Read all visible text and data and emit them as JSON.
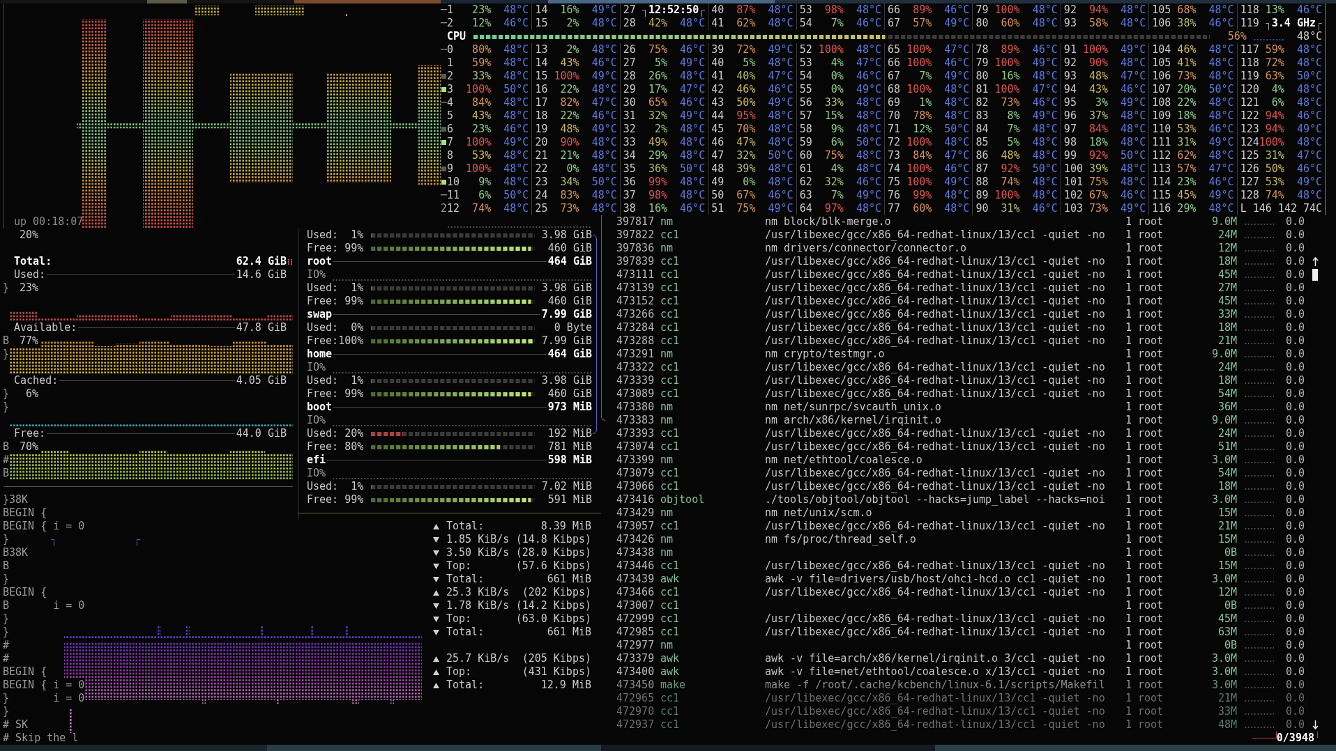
{
  "cpu": {
    "top_rows": [
      {
        "prefix": "─",
        "cores": [
          {
            "kind": "core",
            "id": "1",
            "usage": "23%",
            "color": "#8fca8a",
            "temp": "48°C"
          },
          {
            "kind": "core",
            "id": "14",
            "usage": "16%",
            "color": "#8fca8a",
            "temp": "49°C"
          },
          {
            "kind": "clock",
            "id": "27",
            "text": "12:52:50"
          },
          {
            "kind": "core",
            "id": "40",
            "usage": "87%",
            "color": "#dc5650",
            "temp": "48°C"
          },
          {
            "kind": "core",
            "id": "53",
            "usage": "98%",
            "color": "#dc5650",
            "temp": "48°C"
          },
          {
            "kind": "core",
            "id": "66",
            "usage": "89%",
            "color": "#dc5650",
            "temp": "46°C"
          },
          {
            "kind": "core",
            "id": "79",
            "usage": "100%",
            "color": "#dc5650",
            "temp": "48°C"
          },
          {
            "kind": "core",
            "id": "92",
            "usage": "94%",
            "color": "#dc5650",
            "temp": "48°C"
          },
          {
            "kind": "core",
            "id": "105",
            "usage": "68%",
            "color": "#d4935a",
            "temp": "48°C"
          },
          {
            "kind": "core",
            "id": "118",
            "usage": "13%",
            "color": "#8fca8a",
            "temp": "46°C"
          }
        ]
      },
      {
        "prefix": "─",
        "cores": [
          {
            "kind": "core",
            "id": "2",
            "usage": "12%",
            "color": "#8fca8a",
            "temp": "46°C"
          },
          {
            "kind": "core",
            "id": "15",
            "usage": "2%",
            "color": "#8fca8a",
            "temp": "48°C"
          },
          {
            "kind": "core",
            "id": "28",
            "usage": "42%",
            "color": "#c9b55e",
            "temp": "48°C"
          },
          {
            "kind": "core",
            "id": "41",
            "usage": "62%",
            "color": "#d4935a",
            "temp": "48°C"
          },
          {
            "kind": "core",
            "id": "54",
            "usage": "7%",
            "color": "#8fca8a",
            "temp": "46°C"
          },
          {
            "kind": "core",
            "id": "67",
            "usage": "57%",
            "color": "#d4935a",
            "temp": "49°C"
          },
          {
            "kind": "core",
            "id": "80",
            "usage": "60%",
            "color": "#d4935a",
            "temp": "48°C"
          },
          {
            "kind": "core",
            "id": "93",
            "usage": "58%",
            "color": "#d4935a",
            "temp": "48°C"
          },
          {
            "kind": "core",
            "id": "106",
            "usage": "38%",
            "color": "#b3bd6e",
            "temp": "46°C"
          },
          {
            "kind": "frequency",
            "id": "119",
            "text": "3.4 GHz"
          }
        ]
      }
    ],
    "summary": {
      "label": "CPU",
      "level": 0.56,
      "usage": "56%",
      "temp": "48°C"
    },
    "rows": [
      {
        "prefix": "─",
        "cores": [
          {
            "kind": "core",
            "id": "0",
            "usage": "80%",
            "color": "#d4935a",
            "temp": "48°C"
          },
          {
            "kind": "core",
            "id": "13",
            "usage": "2%",
            "color": "#8fca8a",
            "temp": "48°C"
          },
          {
            "kind": "core",
            "id": "26",
            "usage": "75%",
            "color": "#d4935a",
            "temp": "46°C"
          },
          {
            "kind": "core",
            "id": "39",
            "usage": "72%",
            "color": "#d4935a",
            "temp": "49°C"
          },
          {
            "kind": "core",
            "id": "52",
            "usage": "100%",
            "color": "#dc5650",
            "temp": "48°C"
          },
          {
            "kind": "core",
            "id": "65",
            "usage": "100%",
            "color": "#dc5650",
            "temp": "47°C"
          },
          {
            "kind": "core",
            "id": "78",
            "usage": "89%",
            "color": "#dc5650",
            "temp": "46°C"
          },
          {
            "kind": "core",
            "id": "91",
            "usage": "100%",
            "color": "#dc5650",
            "temp": "49°C"
          },
          {
            "kind": "core",
            "id": "104",
            "usage": "46%",
            "color": "#c9b55e",
            "temp": "48°C"
          },
          {
            "kind": "core",
            "id": "117",
            "usage": "59%",
            "color": "#d4935a",
            "temp": "48°C"
          }
        ]
      },
      {
        "cores": [
          {
            "kind": "core",
            "id": "1",
            "usage": "59%",
            "color": "#d4935a",
            "temp": "48°C"
          },
          {
            "kind": "core",
            "id": "14",
            "usage": "43%",
            "color": "#c9b55e",
            "temp": "46°C"
          },
          {
            "kind": "core",
            "id": "27",
            "usage": "5%",
            "color": "#8fca8a",
            "temp": "49°C"
          },
          {
            "kind": "core",
            "id": "40",
            "usage": "5%",
            "color": "#8fca8a",
            "temp": "48°C"
          },
          {
            "kind": "core",
            "id": "53",
            "usage": "4%",
            "color": "#8fca8a",
            "temp": "47°C"
          },
          {
            "kind": "core",
            "id": "66",
            "usage": "100%",
            "color": "#dc5650",
            "temp": "46°C"
          },
          {
            "kind": "core",
            "id": "79",
            "usage": "100%",
            "color": "#dc5650",
            "temp": "49°C"
          },
          {
            "kind": "core",
            "id": "92",
            "usage": "90%",
            "color": "#dc5650",
            "temp": "48°C"
          },
          {
            "kind": "core",
            "id": "105",
            "usage": "41%",
            "color": "#c9b55e",
            "temp": "48°C"
          },
          {
            "kind": "core",
            "id": "118",
            "usage": "72%",
            "color": "#d4935a",
            "temp": "48°C"
          }
        ]
      },
      {
        "color": "#5a5a5a",
        "cores": [
          {
            "kind": "core",
            "id": "2",
            "usage": "33%",
            "color": "#b3bd6e",
            "temp": "48°C"
          },
          {
            "kind": "core",
            "id": "15",
            "usage": "100%",
            "color": "#dc5650",
            "temp": "49°C"
          },
          {
            "kind": "core",
            "id": "28",
            "usage": "26%",
            "color": "#8fca8a",
            "temp": "48°C"
          },
          {
            "kind": "core",
            "id": "41",
            "usage": "40%",
            "color": "#b3bd6e",
            "temp": "47°C"
          },
          {
            "kind": "core",
            "id": "54",
            "usage": "0%",
            "color": "#8fca8a",
            "temp": "46°C"
          },
          {
            "kind": "core",
            "id": "67",
            "usage": "7%",
            "color": "#8fca8a",
            "temp": "49°C"
          },
          {
            "kind": "core",
            "id": "80",
            "usage": "16%",
            "color": "#8fca8a",
            "temp": "48°C"
          },
          {
            "kind": "core",
            "id": "93",
            "usage": "48%",
            "color": "#c9b55e",
            "temp": "47°C"
          },
          {
            "kind": "core",
            "id": "106",
            "usage": "73%",
            "color": "#d4935a",
            "temp": "48°C"
          },
          {
            "kind": "core",
            "id": "119",
            "usage": "63%",
            "color": "#d4935a",
            "temp": "50°C"
          }
        ]
      },
      {
        "color": "#a6e07c",
        "cores": [
          {
            "kind": "core",
            "id": "3",
            "usage": "100%",
            "color": "#dc5650",
            "temp": "50°C"
          },
          {
            "kind": "core",
            "id": "16",
            "usage": "22%",
            "color": "#8fca8a",
            "temp": "48°C"
          },
          {
            "kind": "core",
            "id": "29",
            "usage": "17%",
            "color": "#8fca8a",
            "temp": "47°C"
          },
          {
            "kind": "core",
            "id": "42",
            "usage": "46%",
            "color": "#c9b55e",
            "temp": "46°C"
          },
          {
            "kind": "core",
            "id": "55",
            "usage": "0%",
            "color": "#8fca8a",
            "temp": "49°C"
          },
          {
            "kind": "core",
            "id": "68",
            "usage": "100%",
            "color": "#dc5650",
            "temp": "48°C"
          },
          {
            "kind": "core",
            "id": "81",
            "usage": "100%",
            "color": "#dc5650",
            "temp": "47°C"
          },
          {
            "kind": "core",
            "id": "94",
            "usage": "43%",
            "color": "#c9b55e",
            "temp": "46°C"
          },
          {
            "kind": "core",
            "id": "107",
            "usage": "20%",
            "color": "#8fca8a",
            "temp": "50°C"
          },
          {
            "kind": "core",
            "id": "120",
            "usage": "4%",
            "color": "#8fca8a",
            "temp": "48°C"
          }
        ]
      },
      {
        "prefix": "─",
        "cores": [
          {
            "kind": "core",
            "id": "4",
            "usage": "84%",
            "color": "#d4935a",
            "temp": "48°C"
          },
          {
            "kind": "core",
            "id": "17",
            "usage": "82%",
            "color": "#d4935a",
            "temp": "47°C"
          },
          {
            "kind": "core",
            "id": "30",
            "usage": "65%",
            "color": "#d4935a",
            "temp": "46°C"
          },
          {
            "kind": "core",
            "id": "43",
            "usage": "50%",
            "color": "#c9b55e",
            "temp": "49°C"
          },
          {
            "kind": "core",
            "id": "56",
            "usage": "33%",
            "color": "#b3bd6e",
            "temp": "48°C"
          },
          {
            "kind": "core",
            "id": "69",
            "usage": "1%",
            "color": "#8fca8a",
            "temp": "48°C"
          },
          {
            "kind": "core",
            "id": "82",
            "usage": "73%",
            "color": "#d4935a",
            "temp": "46°C"
          },
          {
            "kind": "core",
            "id": "95",
            "usage": "3%",
            "color": "#8fca8a",
            "temp": "49°C"
          },
          {
            "kind": "core",
            "id": "108",
            "usage": "22%",
            "color": "#8fca8a",
            "temp": "48°C"
          },
          {
            "kind": "core",
            "id": "121",
            "usage": "6%",
            "color": "#8fca8a",
            "temp": "48°C"
          }
        ]
      },
      {
        "cores": [
          {
            "kind": "core",
            "id": "5",
            "usage": "43%",
            "color": "#c9b55e",
            "temp": "48°C"
          },
          {
            "kind": "core",
            "id": "18",
            "usage": "22%",
            "color": "#8fca8a",
            "temp": "46°C"
          },
          {
            "kind": "core",
            "id": "31",
            "usage": "32%",
            "color": "#b3bd6e",
            "temp": "49°C"
          },
          {
            "kind": "core",
            "id": "44",
            "usage": "95%",
            "color": "#dc5650",
            "temp": "48°C"
          },
          {
            "kind": "core",
            "id": "57",
            "usage": "15%",
            "color": "#8fca8a",
            "temp": "48°C"
          },
          {
            "kind": "core",
            "id": "70",
            "usage": "78%",
            "color": "#d4935a",
            "temp": "48°C"
          },
          {
            "kind": "core",
            "id": "83",
            "usage": "8%",
            "color": "#8fca8a",
            "temp": "49°C"
          },
          {
            "kind": "core",
            "id": "96",
            "usage": "37%",
            "color": "#b3bd6e",
            "temp": "48°C"
          },
          {
            "kind": "core",
            "id": "109",
            "usage": "18%",
            "color": "#8fca8a",
            "temp": "48°C"
          },
          {
            "kind": "core",
            "id": "122",
            "usage": "94%",
            "color": "#dc5650",
            "temp": "46°C"
          }
        ]
      },
      {
        "color": "#5a5a5a",
        "cores": [
          {
            "kind": "core",
            "id": "6",
            "usage": "23%",
            "color": "#8fca8a",
            "temp": "46°C"
          },
          {
            "kind": "core",
            "id": "19",
            "usage": "48%",
            "color": "#c9b55e",
            "temp": "49°C"
          },
          {
            "kind": "core",
            "id": "32",
            "usage": "2%",
            "color": "#8fca8a",
            "temp": "48°C"
          },
          {
            "kind": "core",
            "id": "45",
            "usage": "70%",
            "color": "#d4935a",
            "temp": "48°C"
          },
          {
            "kind": "core",
            "id": "58",
            "usage": "9%",
            "color": "#8fca8a",
            "temp": "48°C"
          },
          {
            "kind": "core",
            "id": "71",
            "usage": "12%",
            "color": "#8fca8a",
            "temp": "50°C"
          },
          {
            "kind": "core",
            "id": "84",
            "usage": "7%",
            "color": "#8fca8a",
            "temp": "48°C"
          },
          {
            "kind": "core",
            "id": "97",
            "usage": "84%",
            "color": "#dc5650",
            "temp": "48°C"
          },
          {
            "kind": "core",
            "id": "110",
            "usage": "53%",
            "color": "#c9b55e",
            "temp": "46°C"
          },
          {
            "kind": "core",
            "id": "123",
            "usage": "94%",
            "color": "#dc5650",
            "temp": "49°C"
          }
        ]
      },
      {
        "color": "#a6e07c",
        "cores": [
          {
            "kind": "core",
            "id": "7",
            "usage": "100%",
            "color": "#dc5650",
            "temp": "49°C"
          },
          {
            "kind": "core",
            "id": "20",
            "usage": "90%",
            "color": "#dc5650",
            "temp": "48°C"
          },
          {
            "kind": "core",
            "id": "33",
            "usage": "49%",
            "color": "#c9b55e",
            "temp": "48°C"
          },
          {
            "kind": "core",
            "id": "46",
            "usage": "47%",
            "color": "#c9b55e",
            "temp": "48°C"
          },
          {
            "kind": "core",
            "id": "59",
            "usage": "6%",
            "color": "#8fca8a",
            "temp": "50°C"
          },
          {
            "kind": "core",
            "id": "72",
            "usage": "100%",
            "color": "#dc5650",
            "temp": "48°C"
          },
          {
            "kind": "core",
            "id": "85",
            "usage": "5%",
            "color": "#8fca8a",
            "temp": "48°C"
          },
          {
            "kind": "core",
            "id": "98",
            "usage": "18%",
            "color": "#8fca8a",
            "temp": "48°C"
          },
          {
            "kind": "core",
            "id": "111",
            "usage": "31%",
            "color": "#b3bd6e",
            "temp": "49°C"
          },
          {
            "kind": "core",
            "id": "124",
            "usage": "100%",
            "color": "#dc5650",
            "temp": "48°C"
          }
        ]
      },
      {
        "cores": [
          {
            "kind": "core",
            "id": "8",
            "usage": "53%",
            "color": "#c9b55e",
            "temp": "48°C"
          },
          {
            "kind": "core",
            "id": "21",
            "usage": "21%",
            "color": "#8fca8a",
            "temp": "48°C"
          },
          {
            "kind": "core",
            "id": "34",
            "usage": "29%",
            "color": "#8fca8a",
            "temp": "48°C"
          },
          {
            "kind": "core",
            "id": "47",
            "usage": "32%",
            "color": "#b3bd6e",
            "temp": "50°C"
          },
          {
            "kind": "core",
            "id": "60",
            "usage": "75%",
            "color": "#d4935a",
            "temp": "48°C"
          },
          {
            "kind": "core",
            "id": "73",
            "usage": "84%",
            "color": "#d4935a",
            "temp": "47°C"
          },
          {
            "kind": "core",
            "id": "86",
            "usage": "48%",
            "color": "#c9b55e",
            "temp": "48°C"
          },
          {
            "kind": "core",
            "id": "99",
            "usage": "92%",
            "color": "#dc5650",
            "temp": "50°C"
          },
          {
            "kind": "core",
            "id": "112",
            "usage": "62%",
            "color": "#d4935a",
            "temp": "48°C"
          },
          {
            "kind": "core",
            "id": "125",
            "usage": "31%",
            "color": "#b3bd6e",
            "temp": "47°C"
          }
        ]
      },
      {
        "color": "#5a5a5a",
        "cores": [
          {
            "kind": "core",
            "id": "9",
            "usage": "100%",
            "color": "#dc5650",
            "temp": "48°C"
          },
          {
            "kind": "core",
            "id": "22",
            "usage": "0%",
            "color": "#8fca8a",
            "temp": "48°C"
          },
          {
            "kind": "core",
            "id": "35",
            "usage": "36%",
            "color": "#b3bd6e",
            "temp": "50°C"
          },
          {
            "kind": "core",
            "id": "48",
            "usage": "39%",
            "color": "#b3bd6e",
            "temp": "48°C"
          },
          {
            "kind": "core",
            "id": "61",
            "usage": "4%",
            "color": "#8fca8a",
            "temp": "48°C"
          },
          {
            "kind": "core",
            "id": "74",
            "usage": "100%",
            "color": "#dc5650",
            "temp": "46°C"
          },
          {
            "kind": "core",
            "id": "87",
            "usage": "92%",
            "color": "#dc5650",
            "temp": "50°C"
          },
          {
            "kind": "core",
            "id": "100",
            "usage": "39%",
            "color": "#b3bd6e",
            "temp": "48°C"
          },
          {
            "kind": "core",
            "id": "113",
            "usage": "57%",
            "color": "#d4935a",
            "temp": "47°C"
          },
          {
            "kind": "core",
            "id": "126",
            "usage": "50%",
            "color": "#c9b55e",
            "temp": "46°C"
          }
        ]
      },
      {
        "color": "#a6e07c",
        "cores": [
          {
            "kind": "core",
            "id": "10",
            "usage": "9%",
            "color": "#8fca8a",
            "temp": "48°C"
          },
          {
            "kind": "core",
            "id": "23",
            "usage": "34%",
            "color": "#b3bd6e",
            "temp": "50°C"
          },
          {
            "kind": "core",
            "id": "36",
            "usage": "99%",
            "color": "#dc5650",
            "temp": "48°C"
          },
          {
            "kind": "core",
            "id": "49",
            "usage": "0%",
            "color": "#8fca8a",
            "temp": "48°C"
          },
          {
            "kind": "core",
            "id": "62",
            "usage": "32%",
            "color": "#b3bd6e",
            "temp": "46°C"
          },
          {
            "kind": "core",
            "id": "75",
            "usage": "100%",
            "color": "#dc5650",
            "temp": "49°C"
          },
          {
            "kind": "core",
            "id": "88",
            "usage": "74%",
            "color": "#d4935a",
            "temp": "48°C"
          },
          {
            "kind": "core",
            "id": "101",
            "usage": "75%",
            "color": "#d4935a",
            "temp": "48°C"
          },
          {
            "kind": "core",
            "id": "114",
            "usage": "23%",
            "color": "#8fca8a",
            "temp": "46°C"
          },
          {
            "kind": "core",
            "id": "127",
            "usage": "53%",
            "color": "#c9b55e",
            "temp": "49°C"
          }
        ]
      },
      {
        "prefix": "─",
        "cores": [
          {
            "kind": "core",
            "id": "11",
            "usage": "6%",
            "color": "#8fca8a",
            "temp": "50°C"
          },
          {
            "kind": "core",
            "id": "24",
            "usage": "83%",
            "color": "#d4935a",
            "temp": "48°C"
          },
          {
            "kind": "core",
            "id": "37",
            "usage": "98%",
            "color": "#dc5650",
            "temp": "48°C"
          },
          {
            "kind": "core",
            "id": "50",
            "usage": "67%",
            "color": "#d4935a",
            "temp": "46°C"
          },
          {
            "kind": "core",
            "id": "63",
            "usage": "7%",
            "color": "#8fca8a",
            "temp": "49°C"
          },
          {
            "kind": "core",
            "id": "76",
            "usage": "99%",
            "color": "#dc5650",
            "temp": "48°C"
          },
          {
            "kind": "core",
            "id": "89",
            "usage": "100%",
            "color": "#dc5650",
            "temp": "48°C"
          },
          {
            "kind": "core",
            "id": "102",
            "usage": "67%",
            "color": "#d4935a",
            "temp": "46°C"
          },
          {
            "kind": "core",
            "id": "115",
            "usage": "45%",
            "color": "#c9b55e",
            "temp": "49°C"
          },
          {
            "kind": "core",
            "id": "128",
            "usage": "74%",
            "color": "#d4935a",
            "temp": "48°C"
          }
        ]
      },
      {
        "prefix": "2",
        "cores": [
          {
            "kind": "core",
            "id": "12",
            "usage": "74%",
            "color": "#d4935a",
            "temp": "48°C"
          },
          {
            "kind": "core",
            "id": "25",
            "usage": "73%",
            "color": "#d4935a",
            "temp": "48°C"
          },
          {
            "kind": "core",
            "id": "38",
            "usage": "16%",
            "color": "#8fca8a",
            "temp": "46°C"
          },
          {
            "kind": "core",
            "id": "51",
            "usage": "75%",
            "color": "#d4935a",
            "temp": "49°C"
          },
          {
            "kind": "core",
            "id": "64",
            "usage": "97%",
            "color": "#dc5650",
            "temp": "48°C"
          },
          {
            "kind": "core",
            "id": "77",
            "usage": "60%",
            "color": "#d4935a",
            "temp": "48°C"
          },
          {
            "kind": "core",
            "id": "90",
            "usage": "31%",
            "color": "#b3bd6e",
            "temp": "46°C"
          },
          {
            "kind": "core",
            "id": "103",
            "usage": "73%",
            "color": "#d4935a",
            "temp": "49°C"
          },
          {
            "kind": "core",
            "id": "116",
            "usage": "29%",
            "color": "#8fca8a",
            "temp": "48°C"
          }
        ],
        "load": "L 146 142 74C"
      }
    ],
    "uptime": "up 00:18:07"
  },
  "memory": {
    "percent_label": "20%",
    "stats": [
      {
        "kind": "total",
        "label": "Total:",
        "value": "62.4 GiB"
      },
      {
        "kind": "used",
        "label": "Used:",
        "value": "14.6 GiB",
        "percent": "23%"
      },
      {
        "kind": "available",
        "label": "Available:",
        "value": "47.8 GiB",
        "percent": "77%"
      },
      {
        "kind": "cached",
        "label": "Cached:",
        "value": "4.05 GiB",
        "percent": "6%"
      },
      {
        "kind": "free",
        "label": "Free:",
        "value": "44.0 GiB",
        "percent": "70%"
      }
    ]
  },
  "disks": {
    "rows": [
      {
        "kind": "used",
        "label": "Used:",
        "percent": "1%",
        "level": 0.01,
        "value": "3.98 GiB"
      },
      {
        "kind": "free",
        "label": "Free:",
        "percent": "99%",
        "level": 0.99,
        "value": "460 GiB"
      },
      {
        "kind": "name",
        "name": "root",
        "size": "464 GiB"
      },
      {
        "kind": "io",
        "label": "IO%"
      },
      {
        "kind": "used",
        "label": "Used:",
        "percent": "1%",
        "level": 0.01,
        "value": "3.98 GiB"
      },
      {
        "kind": "free",
        "label": "Free:",
        "percent": "99%",
        "level": 0.99,
        "value": "460 GiB"
      },
      {
        "kind": "name",
        "name": "swap",
        "size": "7.99 GiB"
      },
      {
        "kind": "used",
        "label": "Used:",
        "percent": "0%",
        "level": 0,
        "value": "0 Byte"
      },
      {
        "kind": "free",
        "label": "Free:",
        "percent": "100%",
        "level": 1,
        "value": "7.99 GiB"
      },
      {
        "kind": "name",
        "name": "home",
        "size": "464 GiB"
      },
      {
        "kind": "io",
        "label": "IO%"
      },
      {
        "kind": "used",
        "label": "Used:",
        "percent": "1%",
        "level": 0.01,
        "value": "3.98 GiB"
      },
      {
        "kind": "free",
        "label": "Free:",
        "percent": "99%",
        "level": 0.99,
        "value": "460 GiB"
      },
      {
        "kind": "name",
        "name": "boot",
        "size": "973 MiB"
      },
      {
        "kind": "io",
        "label": "IO%"
      },
      {
        "kind": "used",
        "label": "Used:",
        "percent": "20%",
        "level": 0.2,
        "value": "192 MiB"
      },
      {
        "kind": "free",
        "label": "Free:",
        "percent": "80%",
        "level": 0.8,
        "value": "781 MiB"
      },
      {
        "kind": "name",
        "name": "efi",
        "size": "598 MiB"
      },
      {
        "kind": "io",
        "label": "IO%"
      },
      {
        "kind": "used",
        "label": "Used:",
        "percent": "1%",
        "level": 0.01,
        "value": "7.02 MiB"
      },
      {
        "kind": "free",
        "label": "Free:",
        "percent": "99%",
        "level": 0.99,
        "value": "591 MiB"
      }
    ]
  },
  "network": {
    "groups": [
      {
        "lines": [
          {
            "kind": "up",
            "label": "Total:",
            "value": "8.39 MiB"
          },
          {
            "kind": "down",
            "label": "1.85 KiB/s",
            "value": "(14.8 Kibps)"
          },
          {
            "kind": "down",
            "label": "3.50 KiB/s",
            "value": "(28.0 Kibps)"
          },
          {
            "kind": "down",
            "label": "Top:",
            "value": "(57.6 Kibps)"
          },
          {
            "kind": "down",
            "label": "Total:",
            "value": "661 MiB"
          },
          {
            "kind": "up",
            "label": "25.3 KiB/s",
            "value": "(202 Kibps)"
          },
          {
            "kind": "down",
            "label": "1.78 KiB/s",
            "value": "(14.2 Kibps)"
          },
          {
            "kind": "down",
            "label": "Top:",
            "value": "(63.0 Kibps)"
          },
          {
            "kind": "down",
            "label": "Total:",
            "value": "661 MiB"
          }
        ]
      },
      {
        "lines": [
          {
            "kind": "up",
            "label": "25.7 KiB/s",
            "value": "(205 Kibps)"
          },
          {
            "kind": "up",
            "label": "Top:",
            "value": "(431 Kibps)"
          },
          {
            "kind": "up",
            "label": "Total:",
            "value": "12.9 MiB"
          }
        ]
      }
    ]
  },
  "stray_text": {
    "margin": [
      "}",
      "B",
      "}",
      "}",
      "}",
      "B",
      "#",
      "B",
      "}38K"
    ],
    "lines": [
      "BEGIN {",
      "BEGIN { i = 0",
      "}",
      "B38K",
      "B",
      "}",
      "BEGIN {",
      "B       i = 0",
      "}",
      "}",
      "#",
      "#",
      "BEGIN {",
      "BEGIN { i = 0",
      "}       i = 0",
      "}",
      "# SK",
      "# Skip the l"
    ]
  },
  "processes": {
    "rows": [
      {
        "pid": "397817",
        "name": "nm",
        "command": "nm block/blk-merge.o",
        "threads": "1",
        "user": "root",
        "memory": "9.0M",
        "cpu": "0.0"
      },
      {
        "pid": "397822",
        "name": "cc1",
        "command": "/usr/libexec/gcc/x86_64-redhat-linux/13/cc1 -quiet -no",
        "threads": "1",
        "user": "root",
        "memory": "24M",
        "cpu": "0.0"
      },
      {
        "pid": "397836",
        "name": "nm",
        "command": "nm drivers/connector/connector.o",
        "threads": "1",
        "user": "root",
        "memory": "12M",
        "cpu": "0.0"
      },
      {
        "pid": "397839",
        "name": "cc1",
        "command": "/usr/libexec/gcc/x86_64-redhat-linux/13/cc1 -quiet -no",
        "threads": "1",
        "user": "root",
        "memory": "18M",
        "cpu": "0.0"
      },
      {
        "pid": "473111",
        "name": "cc1",
        "command": "/usr/libexec/gcc/x86_64-redhat-linux/13/cc1 -quiet -no",
        "threads": "1",
        "user": "root",
        "memory": "45M",
        "cpu": "0.0"
      },
      {
        "pid": "473139",
        "name": "cc1",
        "command": "/usr/libexec/gcc/x86_64-redhat-linux/13/cc1 -quiet -no",
        "threads": "1",
        "user": "root",
        "memory": "27M",
        "cpu": "0.0"
      },
      {
        "pid": "473152",
        "name": "cc1",
        "command": "/usr/libexec/gcc/x86_64-redhat-linux/13/cc1 -quiet -no",
        "threads": "1",
        "user": "root",
        "memory": "45M",
        "cpu": "0.0"
      },
      {
        "pid": "473266",
        "name": "cc1",
        "command": "/usr/libexec/gcc/x86_64-redhat-linux/13/cc1 -quiet -no",
        "threads": "1",
        "user": "root",
        "memory": "33M",
        "cpu": "0.0"
      },
      {
        "pid": "473284",
        "name": "cc1",
        "command": "/usr/libexec/gcc/x86_64-redhat-linux/13/cc1 -quiet -no",
        "threads": "1",
        "user": "root",
        "memory": "18M",
        "cpu": "0.0"
      },
      {
        "pid": "473288",
        "name": "cc1",
        "command": "/usr/libexec/gcc/x86_64-redhat-linux/13/cc1 -quiet -no",
        "threads": "1",
        "user": "root",
        "memory": "21M",
        "cpu": "0.0"
      },
      {
        "pid": "473291",
        "name": "nm",
        "command": "nm crypto/testmgr.o",
        "threads": "1",
        "user": "root",
        "memory": "9.0M",
        "cpu": "0.0"
      },
      {
        "pid": "473322",
        "name": "cc1",
        "command": "/usr/libexec/gcc/x86_64-redhat-linux/13/cc1 -quiet -no",
        "threads": "1",
        "user": "root",
        "memory": "24M",
        "cpu": "0.0"
      },
      {
        "pid": "473339",
        "name": "cc1",
        "command": "/usr/libexec/gcc/x86_64-redhat-linux/13/cc1 -quiet -no",
        "threads": "1",
        "user": "root",
        "memory": "18M",
        "cpu": "0.0"
      },
      {
        "pid": "473089",
        "name": "cc1",
        "command": "/usr/libexec/gcc/x86_64-redhat-linux/13/cc1 -quiet -no",
        "threads": "1",
        "user": "root",
        "memory": "54M",
        "cpu": "0.0"
      },
      {
        "pid": "473380",
        "name": "nm",
        "command": "nm net/sunrpc/svcauth_unix.o",
        "threads": "1",
        "user": "root",
        "memory": "36M",
        "cpu": "0.0"
      },
      {
        "pid": "473383",
        "name": "nm",
        "command": "nm arch/x86/kernel/irqinit.o",
        "threads": "1",
        "user": "root",
        "memory": "9.0M",
        "cpu": "0.0"
      },
      {
        "pid": "473393",
        "name": "cc1",
        "command": "/usr/libexec/gcc/x86_64-redhat-linux/13/cc1 -quiet -no",
        "threads": "1",
        "user": "root",
        "memory": "24M",
        "cpu": "0.0"
      },
      {
        "pid": "473074",
        "name": "cc1",
        "command": "/usr/libexec/gcc/x86_64-redhat-linux/13/cc1 -quiet -no",
        "threads": "1",
        "user": "root",
        "memory": "51M",
        "cpu": "0.0"
      },
      {
        "pid": "473399",
        "name": "nm",
        "command": "nm net/ethtool/coalesce.o",
        "threads": "1",
        "user": "root",
        "memory": "3.0M",
        "cpu": "0.0"
      },
      {
        "pid": "473079",
        "name": "cc1",
        "command": "/usr/libexec/gcc/x86_64-redhat-linux/13/cc1 -quiet -no",
        "threads": "1",
        "user": "root",
        "memory": "54M",
        "cpu": "0.0"
      },
      {
        "pid": "473066",
        "name": "cc1",
        "command": "/usr/libexec/gcc/x86_64-redhat-linux/13/cc1 -quiet -no",
        "threads": "1",
        "user": "root",
        "memory": "18M",
        "cpu": "0.0"
      },
      {
        "pid": "473416",
        "name": "objtool",
        "command": "./tools/objtool/objtool --hacks=jump_label --hacks=noi",
        "threads": "1",
        "user": "root",
        "memory": "3.0M",
        "cpu": "0.0"
      },
      {
        "pid": "473429",
        "name": "nm",
        "command": "nm net/unix/scm.o",
        "threads": "1",
        "user": "root",
        "memory": "15M",
        "cpu": "0.0"
      },
      {
        "pid": "473057",
        "name": "cc1",
        "command": "/usr/libexec/gcc/x86_64-redhat-linux/13/cc1 -quiet -no",
        "threads": "1",
        "user": "root",
        "memory": "21M",
        "cpu": "0.0"
      },
      {
        "pid": "473426",
        "name": "nm",
        "command": "nm fs/proc/thread_self.o",
        "threads": "1",
        "user": "root",
        "memory": "15M",
        "cpu": "0.0"
      },
      {
        "pid": "473438",
        "name": "nm",
        "threads": "1",
        "user": "root",
        "memory": "0B",
        "cpu": "0.0"
      },
      {
        "pid": "473446",
        "name": "cc1",
        "command": "/usr/libexec/gcc/x86_64-redhat-linux/13/cc1 -quiet -no",
        "threads": "1",
        "user": "root",
        "memory": "15M",
        "cpu": "0.0"
      },
      {
        "pid": "473439",
        "name": "awk",
        "command": "awk -v file=drivers/usb/host/ohci-hcd.o cc1 -quiet -no",
        "threads": "1",
        "user": "root",
        "memory": "3.0M",
        "cpu": "0.0"
      },
      {
        "pid": "473466",
        "name": "cc1",
        "command": "/usr/libexec/gcc/x86_64-redhat-linux/13/cc1 -quiet -no",
        "threads": "1",
        "user": "root",
        "memory": "12M",
        "cpu": "0.0"
      },
      {
        "pid": "473007",
        "name": "cc1",
        "threads": "1",
        "user": "root",
        "memory": "0B",
        "cpu": "0.0"
      },
      {
        "pid": "472999",
        "name": "cc1",
        "command": "/usr/libexec/gcc/x86_64-redhat-linux/13/cc1 -quiet -no",
        "threads": "1",
        "user": "root",
        "memory": "45M",
        "cpu": "0.0"
      },
      {
        "pid": "472985",
        "name": "cc1",
        "command": "/usr/libexec/gcc/x86_64-redhat-linux/13/cc1 -quiet -no",
        "threads": "1",
        "user": "root",
        "memory": "63M",
        "cpu": "0.0"
      },
      {
        "pid": "472977",
        "name": "nm",
        "threads": "1",
        "user": "root",
        "memory": "0B",
        "cpu": "0.0"
      },
      {
        "pid": "473379",
        "name": "awk",
        "command": "awk -v file=arch/x86/kernel/irqinit.o 3/cc1 -quiet -no",
        "threads": "1",
        "user": "root",
        "memory": "3.0M",
        "cpu": "0.0"
      },
      {
        "pid": "473400",
        "name": "awk",
        "command": "awk -v file=net/ethtool/coalesce.o x/13/cc1 -quiet -no",
        "threads": "1",
        "user": "root",
        "memory": "3.0M",
        "cpu": "0.0"
      },
      {
        "pid": "473450",
        "name": "make",
        "command": "make -f /root/.cache/kcbench/linux-6.1/scripts/Makefil",
        "threads": "1",
        "user": "root",
        "memory": "3.0M",
        "cpu": "0.0"
      },
      {
        "pid": "472965",
        "name": "cc1",
        "command": "/usr/libexec/gcc/x86_64-redhat-linux/13/cc1 -quiet -no",
        "threads": "1",
        "user": "root",
        "memory": "21M",
        "cpu": "0.0"
      },
      {
        "pid": "472970",
        "name": "cc1",
        "command": "/usr/libexec/gcc/x86_64-redhat-linux/13/cc1 -quiet -no",
        "threads": "1",
        "user": "root",
        "memory": "33M",
        "cpu": "0.0"
      },
      {
        "pid": "472937",
        "name": "cc1",
        "command": "/usr/libexec/gcc/x86_64-redhat-linux/13/cc1 -quiet -no",
        "threads": "1",
        "user": "root",
        "memory": "48M",
        "cpu": "0.0"
      }
    ],
    "count": "0/3948"
  }
}
